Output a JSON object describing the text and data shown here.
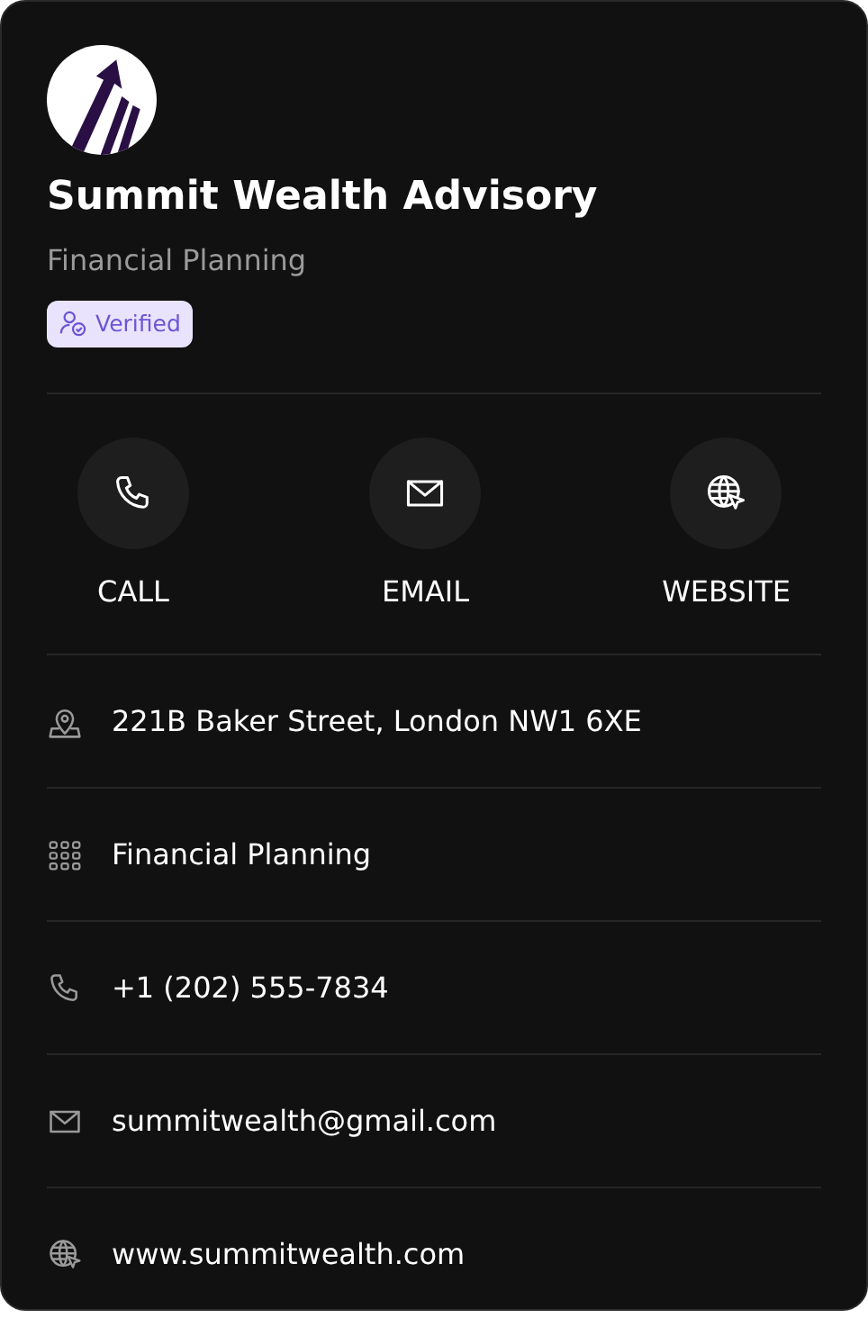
{
  "profile": {
    "name": "Summit Wealth Advisory",
    "category": "Financial Planning",
    "badge": "Verified"
  },
  "actions": [
    {
      "kind": "phone",
      "label": "CALL"
    },
    {
      "kind": "email",
      "label": "EMAIL"
    },
    {
      "kind": "web",
      "label": "WEBSITE"
    }
  ],
  "details": [
    {
      "kind": "address",
      "text": "221B Baker Street, London NW1 6XE"
    },
    {
      "kind": "category",
      "text": "Financial Planning"
    },
    {
      "kind": "phone",
      "text": "+1 (202) 555-7834"
    },
    {
      "kind": "email",
      "text": "summitwealth@gmail.com"
    },
    {
      "kind": "web",
      "text": "www.summitwealth.com"
    }
  ]
}
